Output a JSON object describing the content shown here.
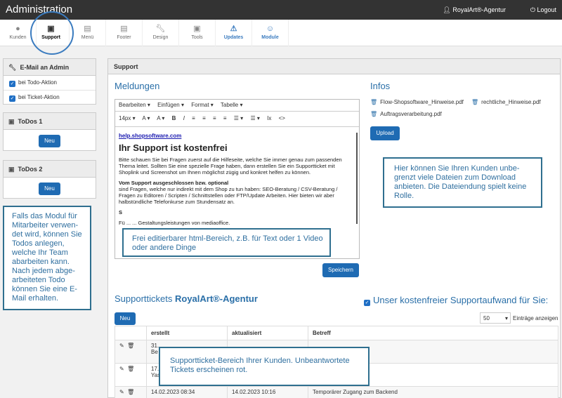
{
  "topbar": {
    "title": "Administration",
    "user": "RoyalArt®-Agentur",
    "logout": "Logout",
    "user_icon": "user-icon",
    "logout_icon": "power-icon"
  },
  "nav": {
    "items": [
      {
        "label": "Kunden",
        "icon": "user-icon"
      },
      {
        "label": "Support",
        "icon": "briefcase-icon"
      },
      {
        "label": "Menü",
        "icon": "menu-icon"
      },
      {
        "label": "Footer",
        "icon": "footer-icon"
      },
      {
        "label": "Design",
        "icon": "wrench-icon"
      },
      {
        "label": "Tools",
        "icon": "toolbox-icon"
      },
      {
        "label": "Updates",
        "icon": "warning-icon"
      },
      {
        "label": "Module",
        "icon": "smiley-icon"
      }
    ],
    "active": "Support",
    "accent": "#3a7bbf"
  },
  "left": {
    "email_title": "E-Mail an Admin",
    "email_items": [
      "bei Todo-Aktion",
      "bei Ticket-Aktion"
    ],
    "todos1_title": "ToDos 1",
    "todos2_title": "ToDos 2",
    "new_label": "Neu",
    "callout": "Falls das Modul für Mitarbeiter verwen-det wird, können Sie Todos anlegen, welche Ihr Team abarbeiten kann. Nach jedem abge-arbeiteten Todo können Sie eine E-Mail erhalten."
  },
  "main": {
    "header": "Support",
    "meldungen_title": "Meldungen",
    "editor": {
      "menu": [
        "Bearbeiten ▾",
        "Einfügen ▾",
        "Format ▾",
        "Tabelle ▾"
      ],
      "toolbar": [
        "14px ▾",
        "A ▾",
        "A ▾",
        "B",
        "I",
        "≡",
        "≡",
        "≡",
        "≡",
        "☰ ▾",
        "☰ ▾",
        "Ix",
        "<>"
      ],
      "link": "help.shopsoftware.com",
      "heading": "Ihr Support ist kostenfrei",
      "p1": "Bitte schauen Sie bei Fragen zuerst auf die Hilfeseite, welche Sie immer genau zum passenden Thema leitet. Sollten Sie eine spezielle Frage haben, dann erstellen Sie ein Supportticket mit Shoplink und Screenshot um Ihnen möglichst zügig und konkret helfen zu können.",
      "p2_title": "Vom Support ausgeschlossen bzw. optional",
      "p2": "sind Fragen, welche nur indirekt mit dem Shop zu tun haben: SEO-Beratung / CSV-Beratung / Fragen zu Editoren / Scripten / Schnittstellen oder FTP/Update Arbeiten. Hier bieten wir aber halbstündliche Telefonkurse zum Stundensatz an.",
      "p3": "S",
      "p4": "Fü ... ... Gestaltungsleistungen von mediaoffice.",
      "callout": "Frei editierbarer html-Bereich, z.B. für Text oder 1 Video oder andere Dinge"
    },
    "save_label": "Speichern",
    "infos_title": "Infos",
    "files": [
      "Flow-Shopsoftware_Hinweise.pdf",
      "rechtliche_Hinweise.pdf",
      "Auftragsverarbeitung.pdf"
    ],
    "upload_label": "Upload",
    "infos_callout": "Hier können Sie Ihren Kunden unbe-grenzt viele Dateien zum Download anbieten. Die Dateiendung spielt keine Rolle.",
    "tickets_title": "Supporttickets",
    "tickets_agency": "RoyalArt®-Agentur",
    "free_support_label": "Unser kostenfreier Supportaufwand für Sie:",
    "new_label": "Neu",
    "page_size": "50",
    "page_size_label": "Einträge anzeigen",
    "columns": [
      "",
      "erstellt",
      "aktualisiert",
      "Betreff"
    ],
    "rows": [
      {
        "created": "31.",
        "created2": "Be",
        "updated": "",
        "subject": ""
      },
      {
        "created": "17.",
        "created2": "Yas",
        "updated": "",
        "subject": ""
      },
      {
        "created": "14.02.2023 08:34",
        "created2": "",
        "updated": "14.02.2023 10:16",
        "subject": "Temporärer Zugang zum Backend"
      }
    ],
    "tickets_callout": "Supportticket-Bereich Ihrer Kunden. Unbeantwortete Tickets erscheinen rot."
  }
}
